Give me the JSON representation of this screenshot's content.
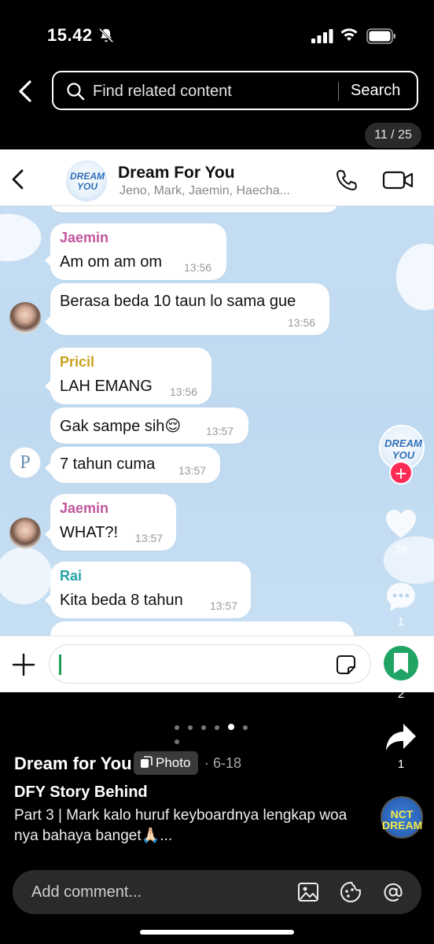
{
  "status_bar": {
    "time": "15.42"
  },
  "search": {
    "placeholder": "Find related content",
    "button": "Search"
  },
  "counter": "11 / 25",
  "chat": {
    "group_name": "Dream For You",
    "members": "Jeno, Mark, Jaemin, Haecha...",
    "group_logo": "DREAM YOU",
    "messages": [
      {
        "sender": "Jaemin",
        "text": "Am om am om",
        "time": "13:56",
        "sender_color": "#c0569c"
      },
      {
        "sender": "",
        "text": "Berasa beda 10 taun lo sama gue",
        "time": "13:56"
      },
      {
        "sender": "Pricil",
        "text": "LAH EMANG",
        "time": "13:56",
        "sender_color": "#c9a21a"
      },
      {
        "sender": "",
        "text": "Gak sampe sih😌",
        "time": "13:57"
      },
      {
        "sender": "",
        "text": "7 tahun cuma",
        "time": "13:57",
        "avatar_letter": "P"
      },
      {
        "sender": "Jaemin",
        "text": "WHAT?!",
        "time": "13:57",
        "sender_color": "#c0569c"
      },
      {
        "sender": "Rai",
        "text": "Kita beda 8 tahun",
        "time": "13:57",
        "sender_color": "#26a3a7"
      }
    ]
  },
  "rail": {
    "likes": "39",
    "comments": "1",
    "saves": "2",
    "shares": "1",
    "creator_logo": "DREAM YOU"
  },
  "post": {
    "author": "Dream for You",
    "type_tag": "Photo",
    "date": "· 6-18",
    "title": "DFY Story Behind",
    "description": "Part 3 | Mark kalo huruf keyboardnya lengkap woa nya bahaya banget🙏🏻...",
    "music_logo": "NCT DREAM"
  },
  "comment_bar": {
    "placeholder": "Add comment..."
  }
}
